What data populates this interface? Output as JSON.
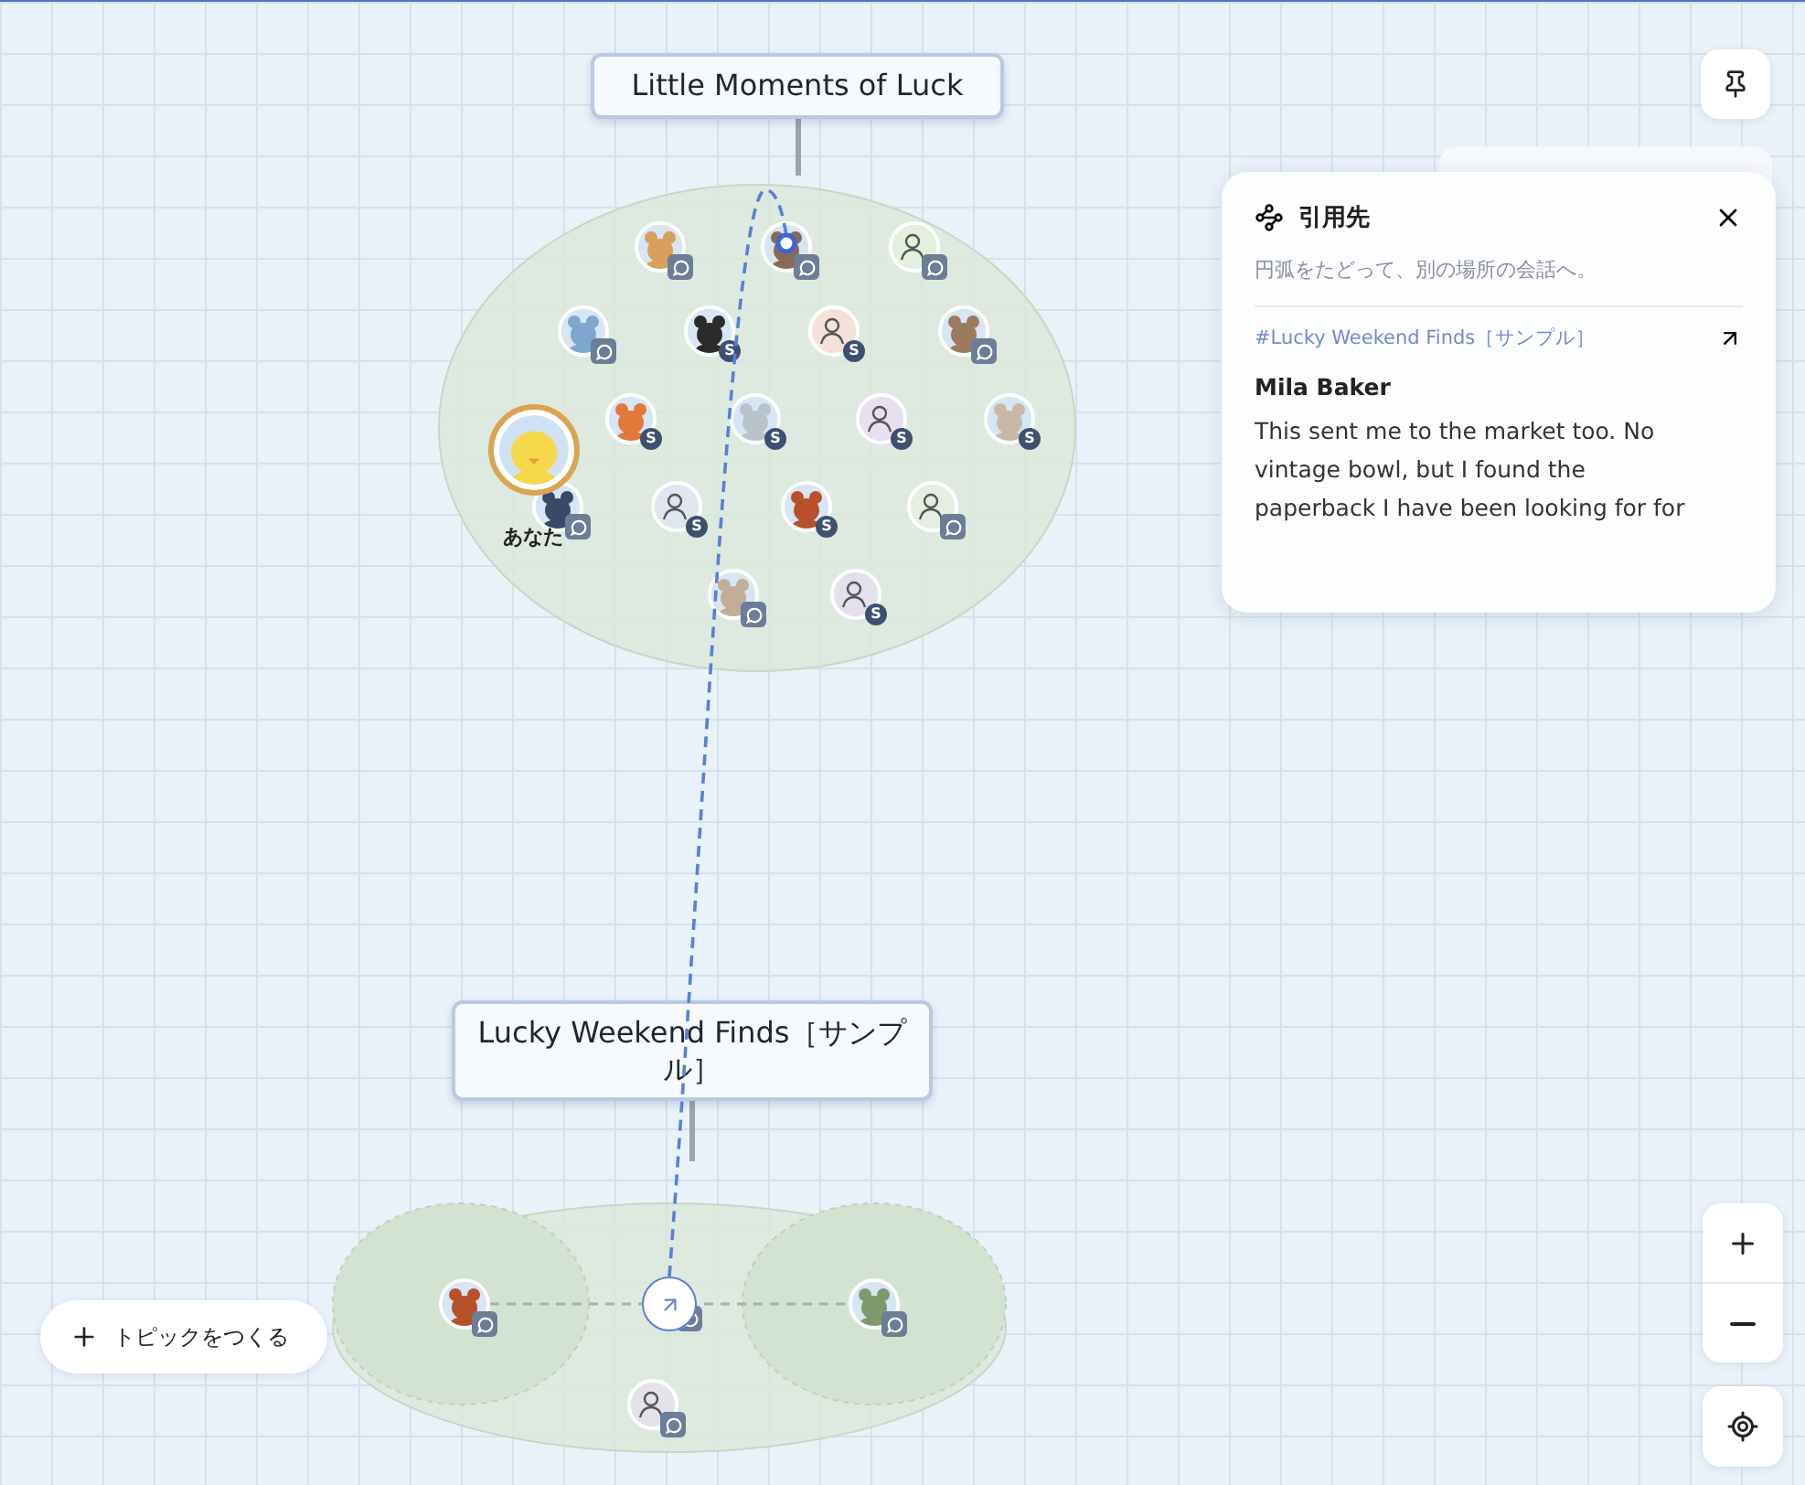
{
  "topics": [
    {
      "title": "Little Moments of Luck",
      "avatars": [
        {
          "kind": "animal",
          "color": "#d9a05b",
          "chat": true
        },
        {
          "kind": "animal",
          "color": "#8a6a55",
          "chat": true
        },
        {
          "kind": "person",
          "color": "#e3f0dc",
          "chat": true
        },
        {
          "kind": "animal",
          "color": "#7fa6cf",
          "chat": true
        },
        {
          "kind": "animal",
          "color": "#2b2b2b",
          "chat": false,
          "badge_text": "S"
        },
        {
          "kind": "person",
          "color": "#f3e2da",
          "chat": false,
          "badge_text": "S"
        },
        {
          "kind": "animal",
          "color": "#9b7a5e",
          "chat": true
        },
        {
          "kind": "animal",
          "color": "#e2783a",
          "chat": false,
          "badge_text": "S"
        },
        {
          "kind": "animal",
          "color": "#b9c3cc",
          "chat": false,
          "badge_text": "S"
        },
        {
          "kind": "person",
          "color": "#e6e0f0",
          "chat": false,
          "badge_text": "S"
        },
        {
          "kind": "animal",
          "color": "#c9b8a8",
          "chat": false,
          "badge_text": "S"
        },
        {
          "kind": "animal",
          "color": "#3a4a66",
          "chat": true
        },
        {
          "kind": "person",
          "color": "#dfe6f0",
          "chat": false,
          "badge_text": "S"
        },
        {
          "kind": "animal",
          "color": "#b8502a",
          "chat": false,
          "badge_text": "S"
        },
        {
          "kind": "person",
          "color": "#e6eee2",
          "chat": true
        },
        {
          "kind": "animal",
          "color": "#c4ad96",
          "chat": true
        },
        {
          "kind": "person",
          "color": "#e4e0ee",
          "chat": false,
          "badge_text": "S"
        },
        {
          "kind": "self",
          "color": "#f7d84a",
          "label": "あなた"
        }
      ]
    },
    {
      "title": "Lucky Weekend Finds［サンプル］",
      "avatars": [
        {
          "kind": "animal",
          "color": "#b8502a",
          "chat": true
        },
        {
          "kind": "animal",
          "color": "#7e9a6a",
          "chat": true
        },
        {
          "kind": "person",
          "color": "#e4e2ea",
          "chat": true
        },
        {
          "kind": "link",
          "chat": true
        }
      ]
    }
  ],
  "quote_panel": {
    "title": "引用先",
    "subtitle": "円弧をたどって、別の場所の会話へ。",
    "link": "#Lucky Weekend Finds［サンプル］",
    "author": "Mila Baker",
    "body": "This sent me to the market too. No vintage bowl, but I found the paperback I have been looking for for"
  },
  "create_button": {
    "label": "トピックをつくる"
  }
}
